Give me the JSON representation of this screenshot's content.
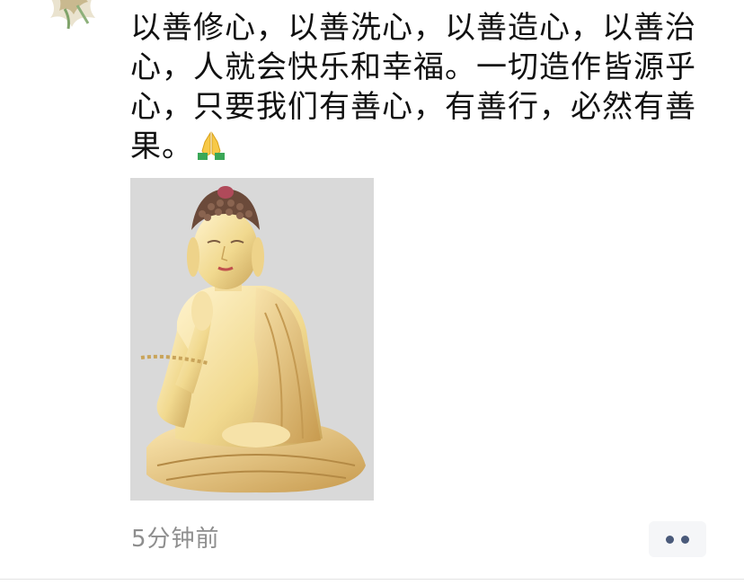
{
  "post": {
    "text": "以善修心，以善洗心，以善造心，以善治心，人就会快乐和幸福。一切造作皆源乎心，只要我们有善心，有善行，必然有善果。",
    "emoji_icon": "folded-hands-icon",
    "image_subject": "golden-buddha-statue",
    "timestamp": "5分钟前"
  },
  "actions": {
    "more_icon": "more-dots-icon"
  },
  "colors": {
    "text": "#111111",
    "timestamp": "#8e8e8e",
    "action_bg": "#f5f6f8",
    "action_dots": "#4a5a7a",
    "image_bg": "#d9d9d9"
  }
}
